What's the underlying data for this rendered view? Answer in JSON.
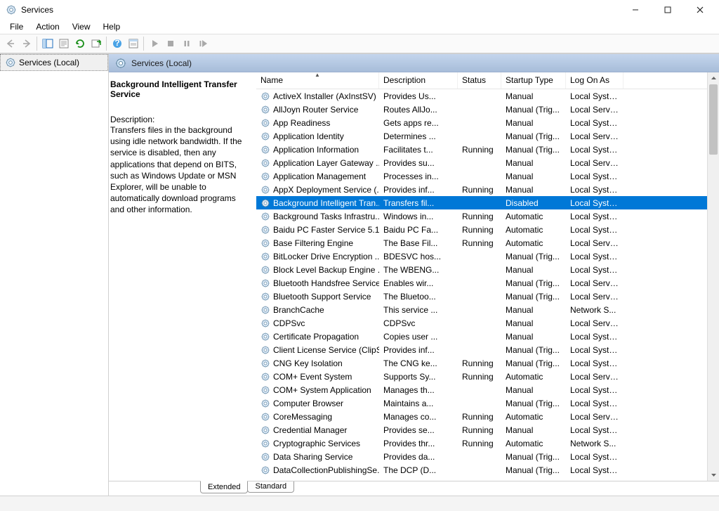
{
  "window": {
    "title": "Services",
    "min": "—",
    "max": "▢",
    "close": "✕"
  },
  "menu": {
    "file": "File",
    "action": "Action",
    "view": "View",
    "help": "Help"
  },
  "tree": {
    "root_label": "Services (Local)"
  },
  "content_header": {
    "title": "Services (Local)"
  },
  "detail": {
    "selected_name": "Background Intelligent Transfer Service",
    "description_label": "Description:",
    "description_text": "Transfers files in the background using idle network bandwidth. If the service is disabled, then any applications that depend on BITS, such as Windows Update or MSN Explorer, will be unable to automatically download programs and other information."
  },
  "columns": {
    "name": "Name",
    "description": "Description",
    "status": "Status",
    "startup": "Startup Type",
    "logon": "Log On As"
  },
  "tabs": {
    "extended": "Extended",
    "standard": "Standard"
  },
  "services": [
    {
      "name": "ActiveX Installer (AxInstSV)",
      "desc": "Provides Us...",
      "status": "",
      "startup": "Manual",
      "logon": "Local Syste..."
    },
    {
      "name": "AllJoyn Router Service",
      "desc": "Routes AllJo...",
      "status": "",
      "startup": "Manual (Trig...",
      "logon": "Local Service"
    },
    {
      "name": "App Readiness",
      "desc": "Gets apps re...",
      "status": "",
      "startup": "Manual",
      "logon": "Local Syste..."
    },
    {
      "name": "Application Identity",
      "desc": "Determines ...",
      "status": "",
      "startup": "Manual (Trig...",
      "logon": "Local Service"
    },
    {
      "name": "Application Information",
      "desc": "Facilitates t...",
      "status": "Running",
      "startup": "Manual (Trig...",
      "logon": "Local Syste..."
    },
    {
      "name": "Application Layer Gateway ...",
      "desc": "Provides su...",
      "status": "",
      "startup": "Manual",
      "logon": "Local Service"
    },
    {
      "name": "Application Management",
      "desc": "Processes in...",
      "status": "",
      "startup": "Manual",
      "logon": "Local Syste..."
    },
    {
      "name": "AppX Deployment Service (...",
      "desc": "Provides inf...",
      "status": "Running",
      "startup": "Manual",
      "logon": "Local Syste..."
    },
    {
      "name": "Background Intelligent Tran...",
      "desc": "Transfers fil...",
      "status": "",
      "startup": "Disabled",
      "logon": "Local Syste...",
      "selected": true
    },
    {
      "name": "Background Tasks Infrastru...",
      "desc": "Windows in...",
      "status": "Running",
      "startup": "Automatic",
      "logon": "Local Syste..."
    },
    {
      "name": "Baidu PC Faster Service 5.1....",
      "desc": "Baidu PC Fa...",
      "status": "Running",
      "startup": "Automatic",
      "logon": "Local Syste..."
    },
    {
      "name": "Base Filtering Engine",
      "desc": "The Base Fil...",
      "status": "Running",
      "startup": "Automatic",
      "logon": "Local Service"
    },
    {
      "name": "BitLocker Drive Encryption ...",
      "desc": "BDESVC hos...",
      "status": "",
      "startup": "Manual (Trig...",
      "logon": "Local Syste..."
    },
    {
      "name": "Block Level Backup Engine ...",
      "desc": "The WBENG...",
      "status": "",
      "startup": "Manual",
      "logon": "Local Syste..."
    },
    {
      "name": "Bluetooth Handsfree Service",
      "desc": "Enables wir...",
      "status": "",
      "startup": "Manual (Trig...",
      "logon": "Local Service"
    },
    {
      "name": "Bluetooth Support Service",
      "desc": "The Bluetoo...",
      "status": "",
      "startup": "Manual (Trig...",
      "logon": "Local Service"
    },
    {
      "name": "BranchCache",
      "desc": "This service ...",
      "status": "",
      "startup": "Manual",
      "logon": "Network S..."
    },
    {
      "name": "CDPSvc",
      "desc": "CDPSvc",
      "status": "",
      "startup": "Manual",
      "logon": "Local Service"
    },
    {
      "name": "Certificate Propagation",
      "desc": "Copies user ...",
      "status": "",
      "startup": "Manual",
      "logon": "Local Syste..."
    },
    {
      "name": "Client License Service (ClipS...",
      "desc": "Provides inf...",
      "status": "",
      "startup": "Manual (Trig...",
      "logon": "Local Syste..."
    },
    {
      "name": "CNG Key Isolation",
      "desc": "The CNG ke...",
      "status": "Running",
      "startup": "Manual (Trig...",
      "logon": "Local Syste..."
    },
    {
      "name": "COM+ Event System",
      "desc": "Supports Sy...",
      "status": "Running",
      "startup": "Automatic",
      "logon": "Local Service"
    },
    {
      "name": "COM+ System Application",
      "desc": "Manages th...",
      "status": "",
      "startup": "Manual",
      "logon": "Local Syste..."
    },
    {
      "name": "Computer Browser",
      "desc": "Maintains a...",
      "status": "",
      "startup": "Manual (Trig...",
      "logon": "Local Syste..."
    },
    {
      "name": "CoreMessaging",
      "desc": "Manages co...",
      "status": "Running",
      "startup": "Automatic",
      "logon": "Local Service"
    },
    {
      "name": "Credential Manager",
      "desc": "Provides se...",
      "status": "Running",
      "startup": "Manual",
      "logon": "Local Syste..."
    },
    {
      "name": "Cryptographic Services",
      "desc": "Provides thr...",
      "status": "Running",
      "startup": "Automatic",
      "logon": "Network S..."
    },
    {
      "name": "Data Sharing Service",
      "desc": "Provides da...",
      "status": "",
      "startup": "Manual (Trig...",
      "logon": "Local Syste..."
    },
    {
      "name": "DataCollectionPublishingSe...",
      "desc": "The DCP (D...",
      "status": "",
      "startup": "Manual (Trig...",
      "logon": "Local Syste..."
    }
  ]
}
